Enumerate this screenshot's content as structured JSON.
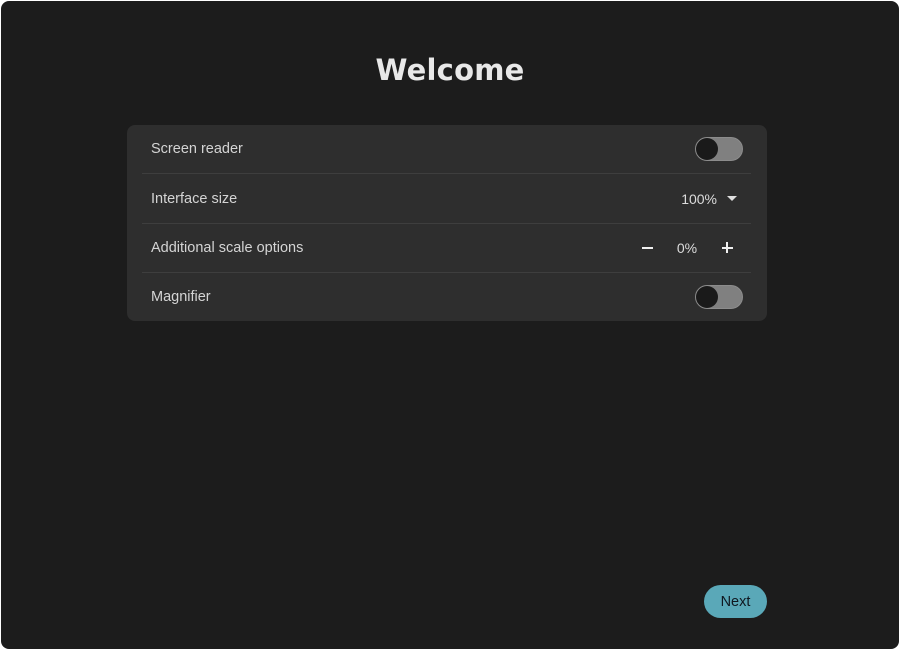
{
  "page": {
    "title": "Welcome"
  },
  "settings": {
    "rows": [
      {
        "label": "Screen reader",
        "control": "toggle",
        "checked": false
      },
      {
        "label": "Interface size",
        "control": "dropdown",
        "value": "100%"
      },
      {
        "label": "Additional scale options",
        "control": "stepper",
        "value": "0%"
      },
      {
        "label": "Magnifier",
        "control": "toggle",
        "checked": false
      }
    ]
  },
  "footer": {
    "next_label": "Next"
  },
  "colors": {
    "background": "#1c1c1c",
    "panel": "#2e2e2e",
    "accent": "#5aa8b8",
    "toggle_off": "#808080"
  },
  "icons": {
    "dropdown": "chevron-down-icon",
    "decrease": "minus-icon",
    "increase": "plus-icon"
  }
}
